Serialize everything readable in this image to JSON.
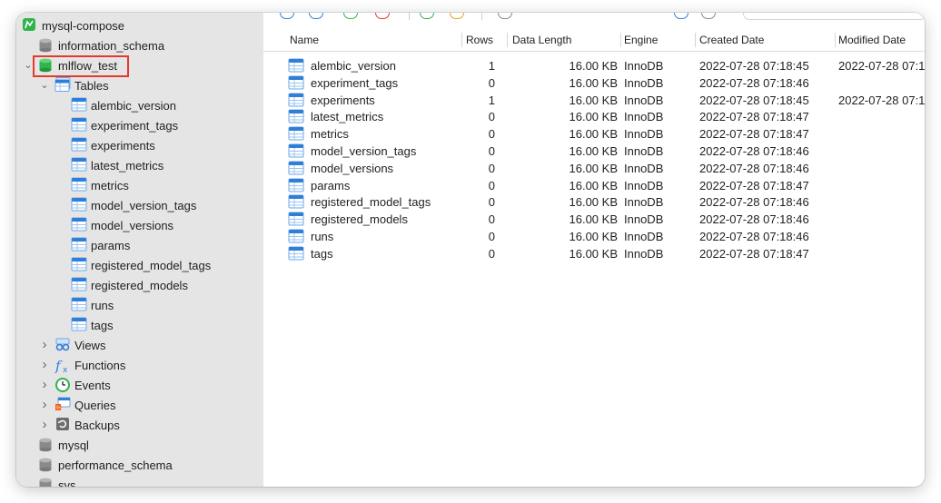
{
  "connection": {
    "name": "mysql-compose"
  },
  "tree": {
    "databases_top": [
      {
        "name": "information_schema"
      }
    ],
    "selected_db": {
      "name": "mlflow_test",
      "tables_group": {
        "label": "Tables",
        "items": [
          "alembic_version",
          "experiment_tags",
          "experiments",
          "latest_metrics",
          "metrics",
          "model_version_tags",
          "model_versions",
          "params",
          "registered_model_tags",
          "registered_models",
          "runs",
          "tags"
        ]
      },
      "groups": [
        "Views",
        "Functions",
        "Events",
        "Queries",
        "Backups"
      ]
    },
    "databases_bottom": [
      {
        "name": "mysql"
      },
      {
        "name": "performance_schema"
      },
      {
        "name": "sys"
      }
    ]
  },
  "table": {
    "columns": [
      "Name",
      "Rows",
      "Data Length",
      "Engine",
      "Created Date",
      "Modified Date"
    ],
    "rows": [
      [
        "alembic_version",
        "1",
        "16.00 KB",
        "InnoDB",
        "2022-07-28 07:18:45",
        "2022-07-28 07:1"
      ],
      [
        "experiment_tags",
        "0",
        "16.00 KB",
        "InnoDB",
        "2022-07-28 07:18:46",
        ""
      ],
      [
        "experiments",
        "1",
        "16.00 KB",
        "InnoDB",
        "2022-07-28 07:18:45",
        "2022-07-28 07:1"
      ],
      [
        "latest_metrics",
        "0",
        "16.00 KB",
        "InnoDB",
        "2022-07-28 07:18:47",
        ""
      ],
      [
        "metrics",
        "0",
        "16.00 KB",
        "InnoDB",
        "2022-07-28 07:18:47",
        ""
      ],
      [
        "model_version_tags",
        "0",
        "16.00 KB",
        "InnoDB",
        "2022-07-28 07:18:46",
        ""
      ],
      [
        "model_versions",
        "0",
        "16.00 KB",
        "InnoDB",
        "2022-07-28 07:18:46",
        ""
      ],
      [
        "params",
        "0",
        "16.00 KB",
        "InnoDB",
        "2022-07-28 07:18:47",
        ""
      ],
      [
        "registered_model_tags",
        "0",
        "16.00 KB",
        "InnoDB",
        "2022-07-28 07:18:46",
        ""
      ],
      [
        "registered_models",
        "0",
        "16.00 KB",
        "InnoDB",
        "2022-07-28 07:18:46",
        ""
      ],
      [
        "runs",
        "0",
        "16.00 KB",
        "InnoDB",
        "2022-07-28 07:18:46",
        ""
      ],
      [
        "tags",
        "0",
        "16.00 KB",
        "InnoDB",
        "2022-07-28 07:18:47",
        ""
      ]
    ]
  },
  "colors": {
    "highlight": "#e33a2b",
    "db_selected": "#2fb34a",
    "table_icon": "#2f7fd6",
    "sidebar_bg": "#e5e5e5"
  },
  "icons": {
    "connection": "mysql-dolphin-icon",
    "database": "database-cylinder-icon",
    "table": "table-grid-icon",
    "views": "views-glasses-icon",
    "functions": "function-fx-icon",
    "events": "clock-icon",
    "queries": "query-icon",
    "backups": "backup-icon"
  }
}
